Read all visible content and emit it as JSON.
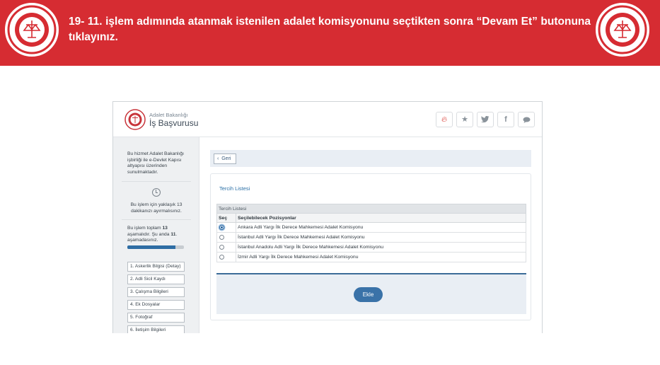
{
  "banner": {
    "instruction": "19- 11. işlem adımında atanmak istenilen adalet komisyonunu seçtikten sonra “Devam Et” butonuna tıklayınız.",
    "seal_caption": "ADALET BAKANLIĞI"
  },
  "header": {
    "org_name": "Adalet Bakanlığı",
    "app_name": "İş Başvurusu",
    "social_icons": [
      "fire-icon",
      "star-icon",
      "twitter-icon",
      "facebook-icon",
      "comment-icon"
    ]
  },
  "sidebar": {
    "info_text": "Bu hizmet Adalet Bakanlığı işbirliği ile e-Devlet Kapısı altyapısı üzerinden sunulmaktadır.",
    "time_text": "Bu işlem için yaklaşık 13 dakikanızı ayırmalısınız.",
    "steps_text_prefix": "Bu işlem toplam ",
    "steps_total": "13",
    "steps_text_middle": " aşamalıdır. Şu anda ",
    "steps_current": "11",
    "steps_text_suffix": ". aşamadasınız.",
    "progress_fraction": 0.85,
    "steps": [
      "1. Askerlik Bilgisi (Detay)",
      "2. Adli Sicil Kaydı",
      "3. Çalışma Bilgileri",
      "4. Ek Dosyalar",
      "5. Fotoğraf",
      "6. İletişim Bilgileri"
    ]
  },
  "main": {
    "back_label": "Geri",
    "card_title": "Tercih Listesi",
    "table_caption": "Tercih Listesi",
    "columns": [
      "Seç",
      "Seçilebilecek Pozisyonlar"
    ],
    "rows": [
      {
        "label": "Ankara Adli Yargı İlk Derece Mahkemesi Adalet Komisyonu",
        "selected": true
      },
      {
        "label": "İstanbul Adli Yargı İlk Derece Mahkemesi Adalet Komisyonu",
        "selected": false
      },
      {
        "label": "İstanbul Anadolu Adli Yargı İlk Derece Mahkemesi Adalet Komisyonu",
        "selected": false
      },
      {
        "label": "İzmir Adli Yargı İlk Derece Mahkemesi Adalet Komisyonu",
        "selected": false
      }
    ],
    "add_label": "Ekle"
  },
  "colors": {
    "banner_red": "#d62c32",
    "accent_blue": "#3a72a8",
    "link_blue": "#2a6fa6"
  }
}
